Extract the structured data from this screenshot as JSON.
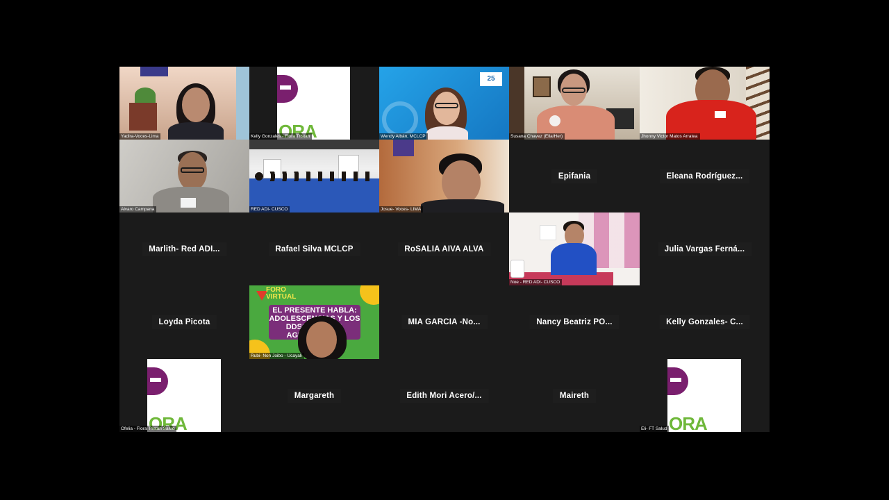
{
  "meeting": {
    "tiles": [
      {
        "id": "yadira",
        "label": "Yadira-Voces-Lima",
        "type": "video"
      },
      {
        "id": "kelly-flora",
        "label": "Kelly Gonzales - Flora Tristan",
        "type": "logo"
      },
      {
        "id": "wendy",
        "label": "Wendy Albán, MCLCP",
        "type": "video"
      },
      {
        "id": "susana",
        "label": "Susana Chavez (Ella/Her)",
        "type": "video"
      },
      {
        "id": "jhonny",
        "label": "Jhonny Victor Matos Arratea",
        "type": "video"
      },
      {
        "id": "alvaro",
        "label": "Alvaro Campana",
        "type": "video"
      },
      {
        "id": "red-adi-1",
        "label": "RED ADI- CUSCO",
        "type": "video"
      },
      {
        "id": "josue",
        "label": "Josue- Voces- LIMA",
        "type": "video"
      },
      {
        "id": "epifania",
        "label": "Epifania",
        "type": "name"
      },
      {
        "id": "eleana",
        "label": "Eleana Rodríguez...",
        "type": "name"
      },
      {
        "id": "marlith",
        "label": "Marlith- Red ADI...",
        "type": "name"
      },
      {
        "id": "rafael",
        "label": "Rafael Silva MCLCP",
        "type": "name"
      },
      {
        "id": "rosalia",
        "label": "RoSALIA AIVA ALVA",
        "type": "name"
      },
      {
        "id": "noe",
        "label": "Noe - RED ADI- CUSCO",
        "type": "video"
      },
      {
        "id": "julia",
        "label": "Julia Vargas Ferná...",
        "type": "name"
      },
      {
        "id": "loyda",
        "label": "Loyda Picota",
        "type": "name"
      },
      {
        "id": "rubi",
        "label": "Rubi- Non Joibo - Ucayali",
        "type": "video"
      },
      {
        "id": "mia",
        "label": "MIA GARCIA -No...",
        "type": "name"
      },
      {
        "id": "nancy",
        "label": "Nancy Beatriz PO...",
        "type": "name"
      },
      {
        "id": "kelly-c",
        "label": "Kelly Gonzales- C...",
        "type": "name"
      },
      {
        "id": "ofelia",
        "label": "Ofelia - Flora Tristan Salud",
        "type": "logo"
      },
      {
        "id": "margareth",
        "label": "Margareth",
        "type": "name"
      },
      {
        "id": "edith",
        "label": "Edith Mori Acero/...",
        "type": "name"
      },
      {
        "id": "maireth",
        "label": "Maireth",
        "type": "name"
      },
      {
        "id": "eli",
        "label": "Eli- FT Salud",
        "type": "logo"
      }
    ],
    "flora_logo_text": "ORA",
    "foro": {
      "header": "FORO VIRTUAL",
      "headline": "EL PRESENTE HABLA: ADOLESCENCIAS Y LOS DDSSRR EN LA AGENDA ELE..."
    },
    "badge_25": "25"
  }
}
